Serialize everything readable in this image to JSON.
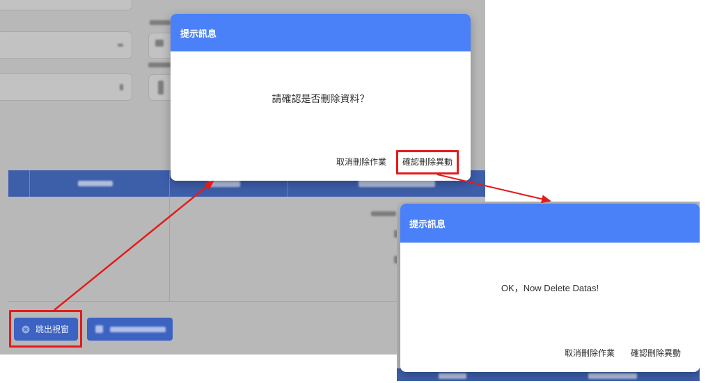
{
  "form_actions": {
    "popup_button_label": "跳出視窗",
    "popup_button_icon": "circle-x-icon"
  },
  "dialog_confirm": {
    "title": "提示訊息",
    "message": "請確認是否刪除資料？",
    "cancel_label": "取消刪除作業",
    "confirm_label": "確認刪除異動"
  },
  "dialog_result": {
    "title": "提示訊息",
    "message": "OK，Now Delete Datas!",
    "cancel_label": "取消刪除作業",
    "confirm_label": "確認刪除異動"
  },
  "colors": {
    "dialog_header": "#4a80f8",
    "highlight_annotation": "#e31b1b",
    "modal_backdrop": "#b8b8b8",
    "dimmed_table_header": "#3d5ea9",
    "dimmed_button": "#3c62c2"
  }
}
